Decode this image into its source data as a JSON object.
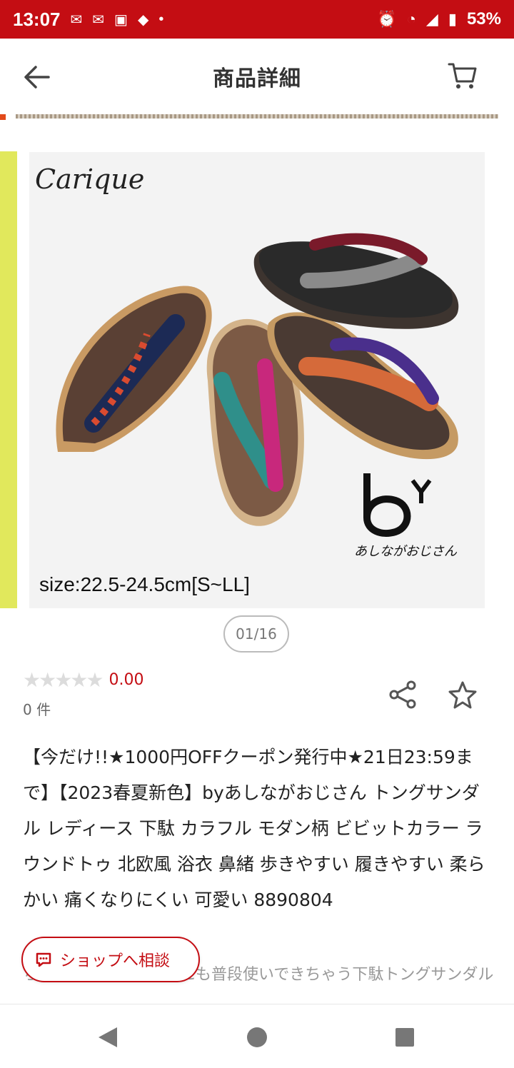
{
  "status_bar": {
    "time": "13:07",
    "battery": "53%",
    "left_icons": [
      "mail-icon",
      "mail-icon",
      "docomo-icon",
      "app-icon",
      "dot-icon"
    ],
    "right_icons": [
      "alarm-icon",
      "wifi-icon",
      "signal-icon",
      "battery-icon"
    ]
  },
  "header": {
    "title": "商品詳細",
    "back_icon": "back-arrow-icon",
    "cart_icon": "cart-icon"
  },
  "product": {
    "image_counter": "01/16",
    "image_logo": "Carique",
    "image_by_logo_text": "あしながおじさん",
    "image_size_label": "size:22.5-24.5cm[S~LL]",
    "rating_stars": "★★★★★",
    "rating_value": "0.00",
    "review_count": "0 件",
    "title": "【今だけ!!★1000円OFFクーポン発行中★21日23:59まで】【2023春夏新色】byあしながおじさん トングサンダル レディース 下駄 カラフル モダン柄 ビビットカラー ラウンドトゥ 北欧風 浴衣 鼻緒 歩きやすい 履きやすい 柔らかい 痛くなりにくい 可愛い 8890804",
    "subtitle": "ちょっとしたお出かけにも普段使いできちゃう下駄トングサンダル"
  },
  "actions": {
    "consult_label": "ショップへ相談",
    "share_icon": "share-icon",
    "favorite_icon": "star-outline-icon"
  },
  "colors": {
    "brand_red": "#c40d13",
    "accent_yellow": "#e1e85c"
  },
  "nav": {
    "icons": [
      "nav-back-icon",
      "nav-home-icon",
      "nav-recent-icon"
    ]
  }
}
